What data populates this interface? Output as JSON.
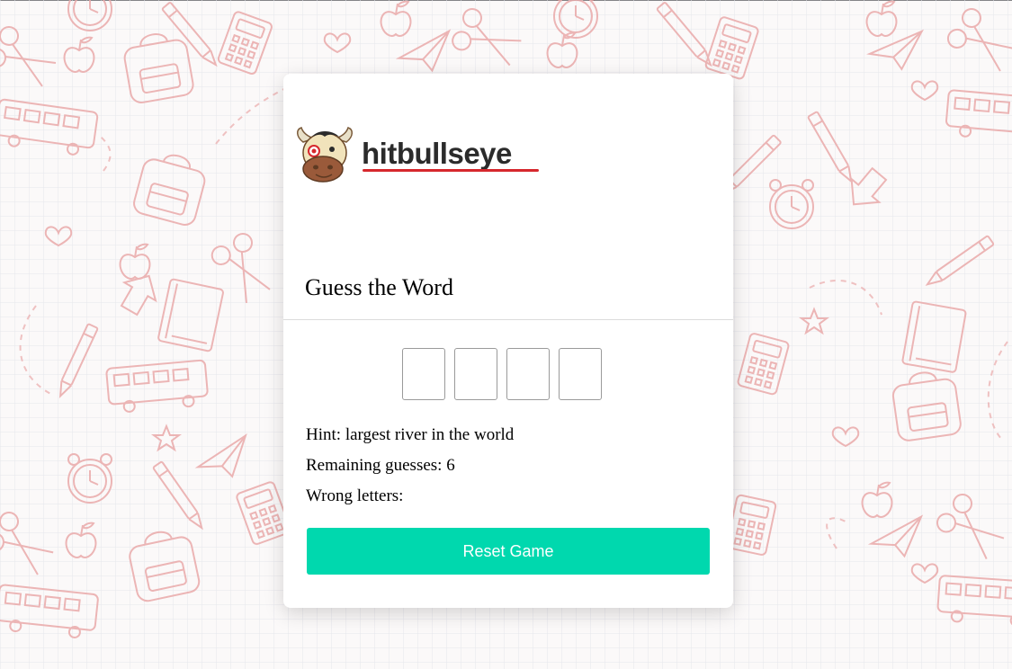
{
  "logo": {
    "text": "hitbullseye"
  },
  "game": {
    "title": "Guess the Word",
    "slots": [
      "",
      "",
      "",
      ""
    ],
    "hint_label": "Hint: ",
    "hint_value": "largest river in the world",
    "remaining_label": "Remaining guesses: ",
    "remaining_value": "6",
    "wrong_label": "Wrong letters:",
    "wrong_value": "",
    "reset_label": "Reset Game"
  },
  "colors": {
    "accent": "#00d8ae",
    "logo_red": "#d6272d",
    "doodle_pink": "#e9a9a9"
  }
}
